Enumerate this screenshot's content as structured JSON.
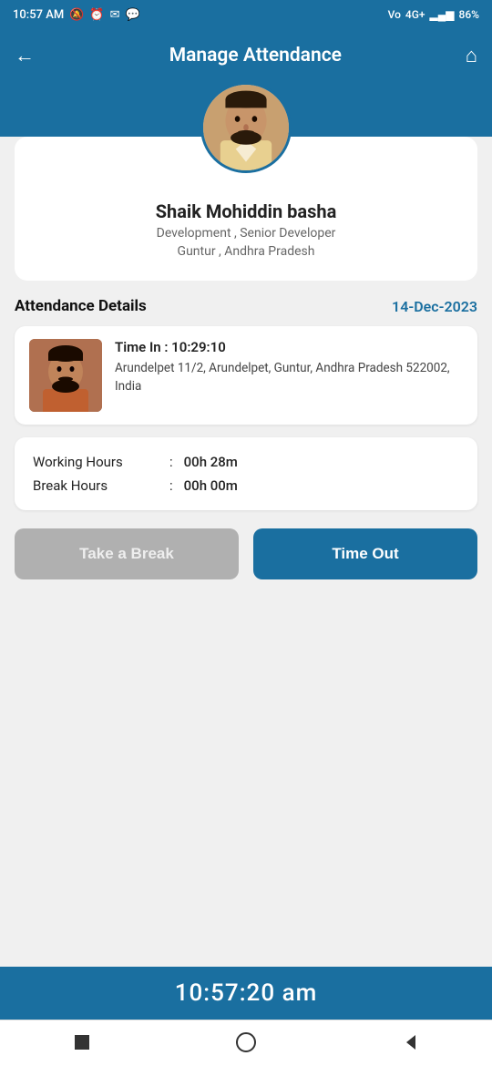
{
  "statusBar": {
    "time": "10:57 AM",
    "batteryLevel": "86"
  },
  "header": {
    "title": "Manage Attendance",
    "backIcon": "←",
    "homeIcon": "⌂"
  },
  "profile": {
    "name": "Shaik Mohiddin basha",
    "role": "Development  , Senior Developer",
    "location": "Guntur , Andhra Pradesh"
  },
  "attendance": {
    "sectionTitle": "Attendance Details",
    "date": "14-Dec-2023",
    "timeIn": "Time In : 10:29:10",
    "address": "Arundelpet 11/2, Arundelpet, Guntur, Andhra Pradesh 522002, India"
  },
  "hours": {
    "workingHoursLabel": "Working Hours",
    "workingHoursValue": "00h 28m",
    "breakHoursLabel": "Break Hours",
    "breakHoursValue": "00h 00m",
    "colon": ":"
  },
  "buttons": {
    "breakLabel": "Take a Break",
    "timeoutLabel": "Time Out"
  },
  "bottomBar": {
    "time": "10:57:20 am"
  }
}
